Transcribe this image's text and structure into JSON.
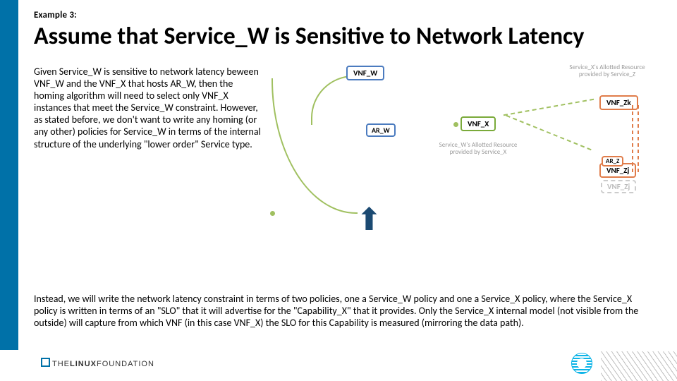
{
  "example_label": "Example 3:",
  "title": "Assume that Service_W is Sensitive to Network Latency",
  "paragraph1": "Given Service_W is sensitive to network latency beween VNF_W and the VNF_X that hosts AR_W, then the homing algorithm will need to select only VNF_X instances that meet the Service_W constraint.  However, as stated before, we don't want to write any homing (or any other) policies for Service_W in terms of the internal structure of the underlying \"lower order\" Service type.",
  "paragraph2": "Instead, we will write the network latency constraint in terms of two policies, one a Service_W policy and one a Service_X policy, where the Service_X policy is written in terms of an \"SLO\" that it will advertise for the \"Capability_X\" that it provides.   Only the Service_X internal model (not visible from the outside) will capture from which VNF (in this case VNF_X) the SLO for this Capability is measured (mirroring the data path).",
  "diagram": {
    "vnf_w": "VNF_W",
    "ar_w": "AR_W",
    "vnf_x": "VNF_X",
    "vnf_zk": "VNF_Zk",
    "vnf_zj": "VNF_Zj",
    "vnf_zj_ghost": "VNF_Zj",
    "ar_z": "AR_Z",
    "label_z": "Service_X's Allotted Resource provided by Service_Z",
    "label_x": "Service_W's Allotted Resource provided by Service_X"
  },
  "footer": {
    "linux_prefix": "THE",
    "linux_main": "LINUX",
    "linux_suffix": "FOUNDATION"
  }
}
